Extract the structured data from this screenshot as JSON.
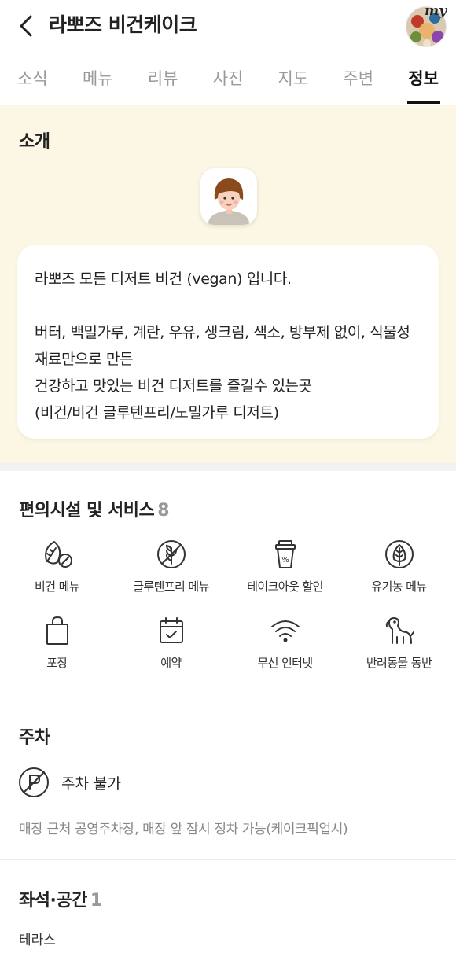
{
  "header": {
    "title": "라뽀즈 비건케이크",
    "avatar_label": "my",
    "back_icon": "chevron-left-icon"
  },
  "tabs": [
    {
      "label": "소식",
      "active": false
    },
    {
      "label": "메뉴",
      "active": false
    },
    {
      "label": "리뷰",
      "active": false
    },
    {
      "label": "사진",
      "active": false
    },
    {
      "label": "지도",
      "active": false
    },
    {
      "label": "주변",
      "active": false
    },
    {
      "label": "정보",
      "active": true
    }
  ],
  "intro": {
    "title": "소개",
    "lines": [
      "라뽀즈 모든 디저트 비건 (vegan) 입니다.",
      "",
      "버터, 백밀가루, 계란, 우유, 생크림, 색소, 방부제 없이, 식물성 재료만으로 만든",
      "건강하고 맛있는 비건 디저트를 즐길수 있는곳",
      "(비건/비건 글루텐프리/노밀가루 디저트)"
    ],
    "background_color": "#fcf7e4"
  },
  "amenities": {
    "title": "편의시설 및 서비스",
    "count": "8",
    "items": [
      {
        "label": "비건 메뉴",
        "icon": "vegan-leaf-icon"
      },
      {
        "label": "글루텐프리 메뉴",
        "icon": "gluten-free-icon"
      },
      {
        "label": "테이크아웃 할인",
        "icon": "takeout-cup-icon"
      },
      {
        "label": "유기농 메뉴",
        "icon": "organic-leaf-icon"
      },
      {
        "label": "포장",
        "icon": "bag-icon"
      },
      {
        "label": "예약",
        "icon": "calendar-check-icon"
      },
      {
        "label": "무선 인터넷",
        "icon": "wifi-icon"
      },
      {
        "label": "반려동물 동반",
        "icon": "dog-icon"
      }
    ]
  },
  "parking": {
    "title": "주차",
    "status": "주차 불가",
    "status_icon": "no-parking-icon",
    "note": "매장 근처 공영주차장, 매장 앞 잠시 정차 가능(케이크픽업시)"
  },
  "seating": {
    "title": "좌석·공간",
    "count": "1",
    "items": [
      "테라스"
    ]
  }
}
